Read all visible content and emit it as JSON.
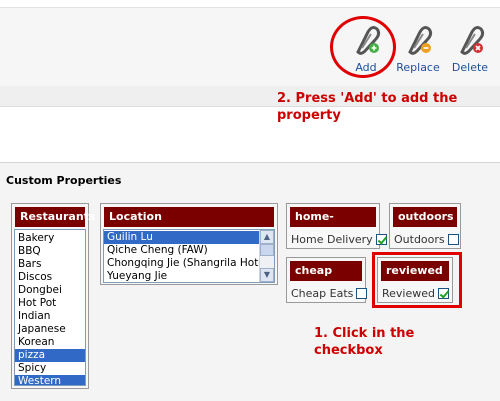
{
  "toolbar": {
    "buttons": [
      {
        "label": "Add",
        "icon": "add-clip-icon",
        "badge_color": "#44b044"
      },
      {
        "label": "Replace",
        "icon": "replace-clip-icon",
        "badge_color": "#f0a020"
      },
      {
        "label": "Delete",
        "icon": "delete-clip-icon",
        "badge_color": "#d03030"
      }
    ]
  },
  "annotations": {
    "press_add": "2. Press 'Add' to add the property",
    "click_checkbox": "1. Click in the checkbox"
  },
  "custom_properties": {
    "title": "Custom Properties",
    "restaurants": {
      "header": "Restaurants",
      "items": [
        "Bakery",
        "BBQ",
        "Bars",
        "Discos",
        "Dongbei",
        "Hot Pot",
        "Indian",
        "Japanese",
        "Korean",
        "pizza",
        "Spicy",
        "Western"
      ],
      "selected": [
        "pizza",
        "Western"
      ]
    },
    "location": {
      "header": "Location",
      "items": [
        "Guilin Lu",
        "Qiche Cheng (FAW)",
        "Chongqing Jie (Shangrila Hotel)",
        "Yueyang Jie"
      ],
      "selected": [
        "Guilin Lu"
      ]
    },
    "home_delivery": {
      "header": "home-delivery",
      "label": "Home Delivery",
      "checked": true
    },
    "outdoors": {
      "header": "outdoors",
      "label": "Outdoors",
      "checked": false
    },
    "cheap": {
      "header": "cheap",
      "label": "Cheap Eats",
      "checked": false
    },
    "reviewed": {
      "header": "reviewed",
      "label": "Reviewed",
      "checked": true
    }
  },
  "colors": {
    "header_bg": "#7a0000",
    "annotation_red": "#cc0000",
    "selection_blue": "#3169c6",
    "toolbar_label": "#1d4f9a"
  }
}
